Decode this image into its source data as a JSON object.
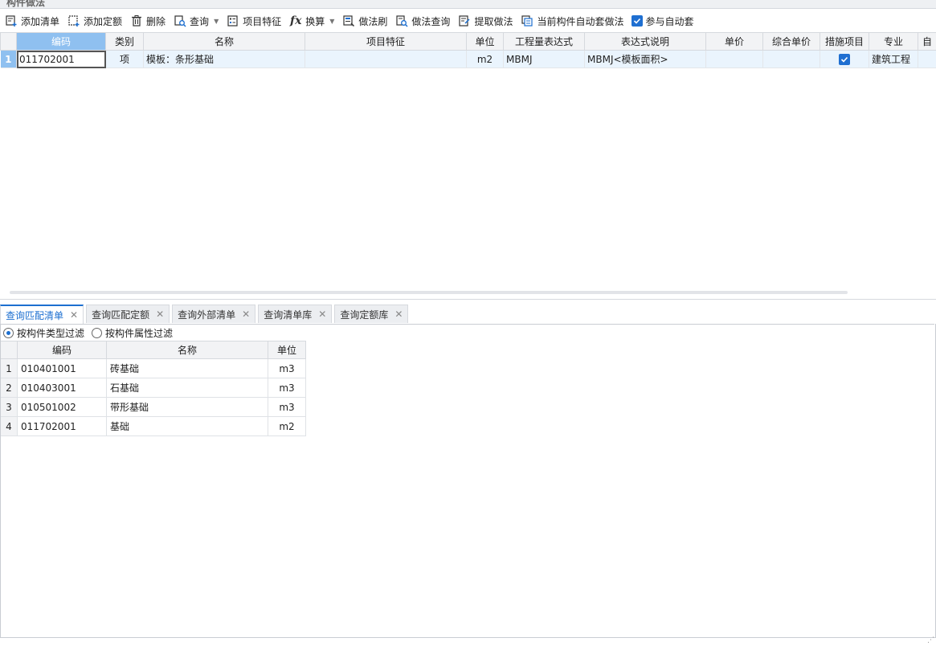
{
  "panel_title": "构件做法",
  "toolbar": {
    "add_list": "添加清单",
    "add_quota": "添加定额",
    "delete": "删除",
    "query": "查询",
    "item_feature": "项目特征",
    "convert": "换算",
    "method_brush": "做法刷",
    "method_query": "做法查询",
    "extract_method": "提取做法",
    "current_auto_method": "当前构件自动套做法",
    "auto_apply": "参与自动套",
    "auto_apply_checked": true
  },
  "top_grid": {
    "headers": [
      "编码",
      "类别",
      "名称",
      "项目特征",
      "单位",
      "工程量表达式",
      "表达式说明",
      "单价",
      "综合单价",
      "措施项目",
      "专业",
      "自"
    ],
    "rows": [
      {
        "index": "1",
        "code": "011702001",
        "type": "项",
        "name": "模板：条形基础",
        "feature": "",
        "unit": "m2",
        "expr": "MBMJ",
        "expr_desc": "MBMJ<模板面积>",
        "price": "",
        "total_price": "",
        "measure_checked": true,
        "major": "建筑工程"
      }
    ]
  },
  "tabs": [
    {
      "label": "查询匹配清单",
      "active": true
    },
    {
      "label": "查询匹配定额",
      "active": false
    },
    {
      "label": "查询外部清单",
      "active": false
    },
    {
      "label": "查询清单库",
      "active": false
    },
    {
      "label": "查询定额库",
      "active": false
    }
  ],
  "filters": {
    "by_type": "按构件类型过滤",
    "by_attr": "按构件属性过滤",
    "selected": "by_type"
  },
  "bottom_grid": {
    "headers": [
      "编码",
      "名称",
      "单位"
    ],
    "rows": [
      {
        "index": "1",
        "code": "010401001",
        "name": "砖基础",
        "unit": "m3"
      },
      {
        "index": "2",
        "code": "010403001",
        "name": "石基础",
        "unit": "m3"
      },
      {
        "index": "3",
        "code": "010501002",
        "name": "带形基础",
        "unit": "m3"
      },
      {
        "index": "4",
        "code": "011702001",
        "name": "基础",
        "unit": "m2"
      }
    ]
  },
  "colors": {
    "accent": "#1c6fd0",
    "selected_header": "#8fc0f0",
    "selected_row": "#eaf4fd"
  }
}
